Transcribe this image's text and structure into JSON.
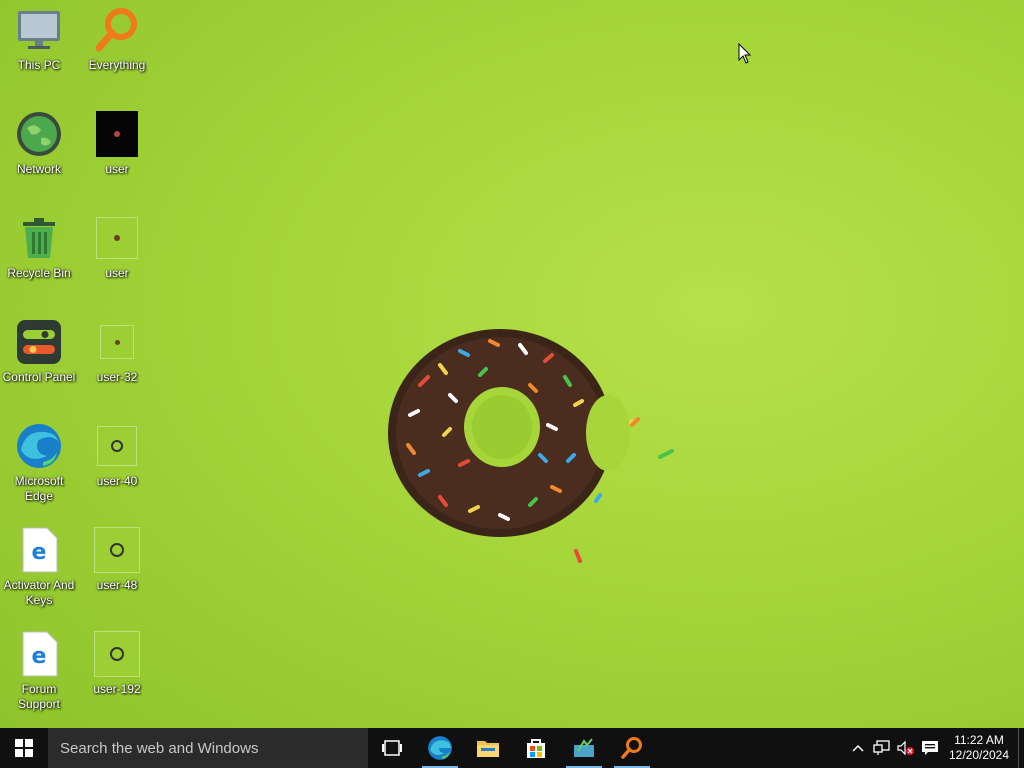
{
  "desktop": {
    "icons": [
      {
        "label": "This PC",
        "icon": "monitor-icon"
      },
      {
        "label": "Everything",
        "icon": "magnifier-icon"
      },
      {
        "label": "Network",
        "icon": "globe-icon"
      },
      {
        "label": "user",
        "icon": "image-file-icon"
      },
      {
        "label": "Recycle Bin",
        "icon": "recycle-bin-icon"
      },
      {
        "label": "user",
        "icon": "image-file-icon"
      },
      {
        "label": "Control Panel",
        "icon": "control-panel-icon"
      },
      {
        "label": "user-32",
        "icon": "image-file-icon"
      },
      {
        "label": "Microsoft Edge",
        "icon": "edge-icon"
      },
      {
        "label": "user-40",
        "icon": "image-file-icon"
      },
      {
        "label": "Activator And Keys",
        "icon": "ie-shortcut-icon"
      },
      {
        "label": "user-48",
        "icon": "image-file-icon"
      },
      {
        "label": "Forum Support",
        "icon": "ie-shortcut-icon"
      },
      {
        "label": "user-192",
        "icon": "image-file-icon"
      }
    ]
  },
  "taskbar": {
    "search_placeholder": "Search the web and Windows",
    "apps": [
      "task-view-icon",
      "edge-icon",
      "file-explorer-icon",
      "store-icon",
      "app-icon",
      "everything-icon"
    ],
    "clock": {
      "time": "11:22 AM",
      "date": "12/20/2024"
    }
  },
  "colors": {
    "accent": "#76b9ed",
    "taskbar": "#101010",
    "wallpaper": "#a6d63a"
  }
}
